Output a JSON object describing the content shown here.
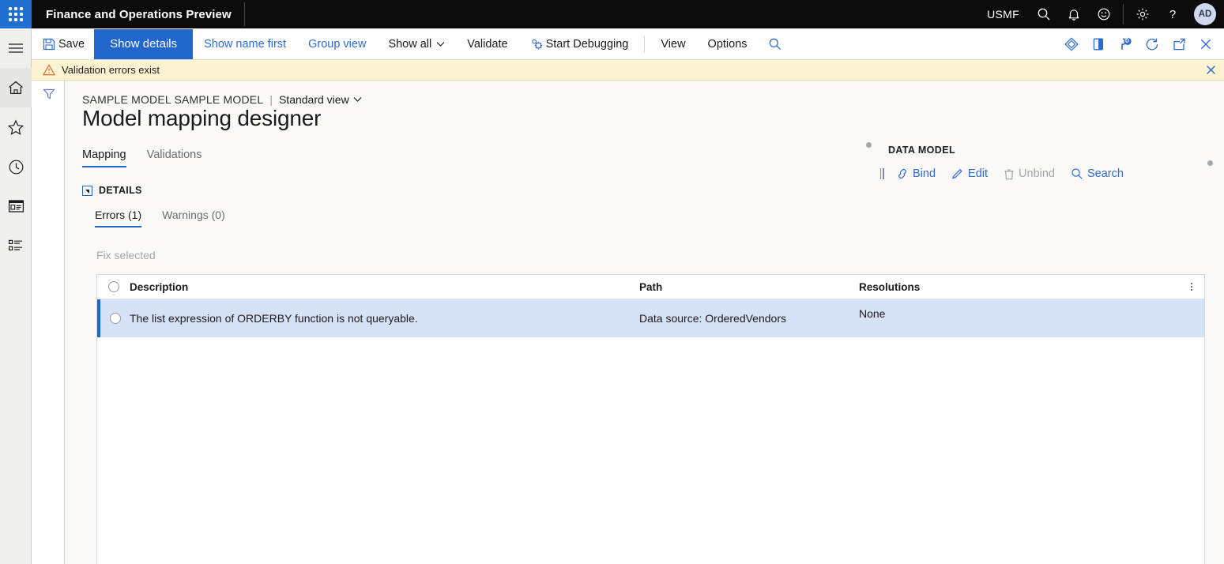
{
  "topbar": {
    "app_title": "Finance and Operations Preview",
    "company": "USMF",
    "avatar_initials": "AD",
    "icons": [
      "waffle-icon",
      "search-icon",
      "bell-icon",
      "feedback-smiley-icon",
      "gear-icon",
      "help-icon"
    ]
  },
  "toolbar": {
    "save_label": "Save",
    "show_details_label": "Show details",
    "show_name_first_label": "Show name first",
    "group_view_label": "Group view",
    "show_all_label": "Show all",
    "validate_label": "Validate",
    "start_debugging_label": "Start Debugging",
    "view_label": "View",
    "options_label": "Options",
    "right_icons": [
      "attach-icon",
      "open-in-new-window-icon",
      "pin-notification-icon",
      "refresh-icon",
      "popout-icon",
      "close-icon"
    ],
    "notification_badge": "0"
  },
  "message_bar": {
    "text": "Validation errors exist",
    "icon": "warning-triangle-icon",
    "close_icon": "close-icon"
  },
  "rail": {
    "items": [
      {
        "name": "hamburger-menu",
        "icon": "hamburger-icon"
      },
      {
        "name": "home",
        "icon": "home-icon"
      },
      {
        "name": "favorites",
        "icon": "star-icon"
      },
      {
        "name": "recent",
        "icon": "clock-icon"
      },
      {
        "name": "workspaces",
        "icon": "workspace-icon"
      },
      {
        "name": "modules",
        "icon": "list-icon"
      }
    ]
  },
  "filter_col": {
    "icon": "filter-funnel-icon"
  },
  "page": {
    "breadcrumb_model": "SAMPLE MODEL SAMPLE MODEL",
    "breadcrumb_separator": "|",
    "breadcrumb_view": "Standard view",
    "title": "Model mapping designer",
    "tabs": [
      {
        "label": "Mapping",
        "active": true
      },
      {
        "label": "Validations",
        "active": false
      }
    ],
    "details_label": "DETAILS",
    "subtabs": [
      {
        "label": "Errors (1)",
        "active": true
      },
      {
        "label": "Warnings (0)",
        "active": false
      }
    ],
    "fix_selected_label": "Fix selected"
  },
  "grid": {
    "columns": [
      "Description",
      "Path",
      "Resolutions"
    ],
    "rows": [
      {
        "description": "The list expression of ORDERBY function is not queryable.",
        "path": "Data source: OrderedVendors",
        "resolutions": "None",
        "selected": true
      }
    ]
  },
  "data_model": {
    "title": "DATA MODEL",
    "actions": [
      {
        "label": "Bind",
        "icon": "link-icon",
        "disabled": false
      },
      {
        "label": "Edit",
        "icon": "pencil-icon",
        "disabled": false
      },
      {
        "label": "Unbind",
        "icon": "trash-icon",
        "disabled": true
      },
      {
        "label": "Search",
        "icon": "search-icon",
        "disabled": false
      }
    ]
  },
  "colors": {
    "accent": "#2266cc",
    "link": "#2f6bce",
    "topbar_bg": "#0b0b0b",
    "waffle_bg": "#1f6fd0",
    "warning_bg": "#fdf3d3",
    "row_selected_bg": "#d6e2f8",
    "page_bg": "#faf9f8"
  }
}
